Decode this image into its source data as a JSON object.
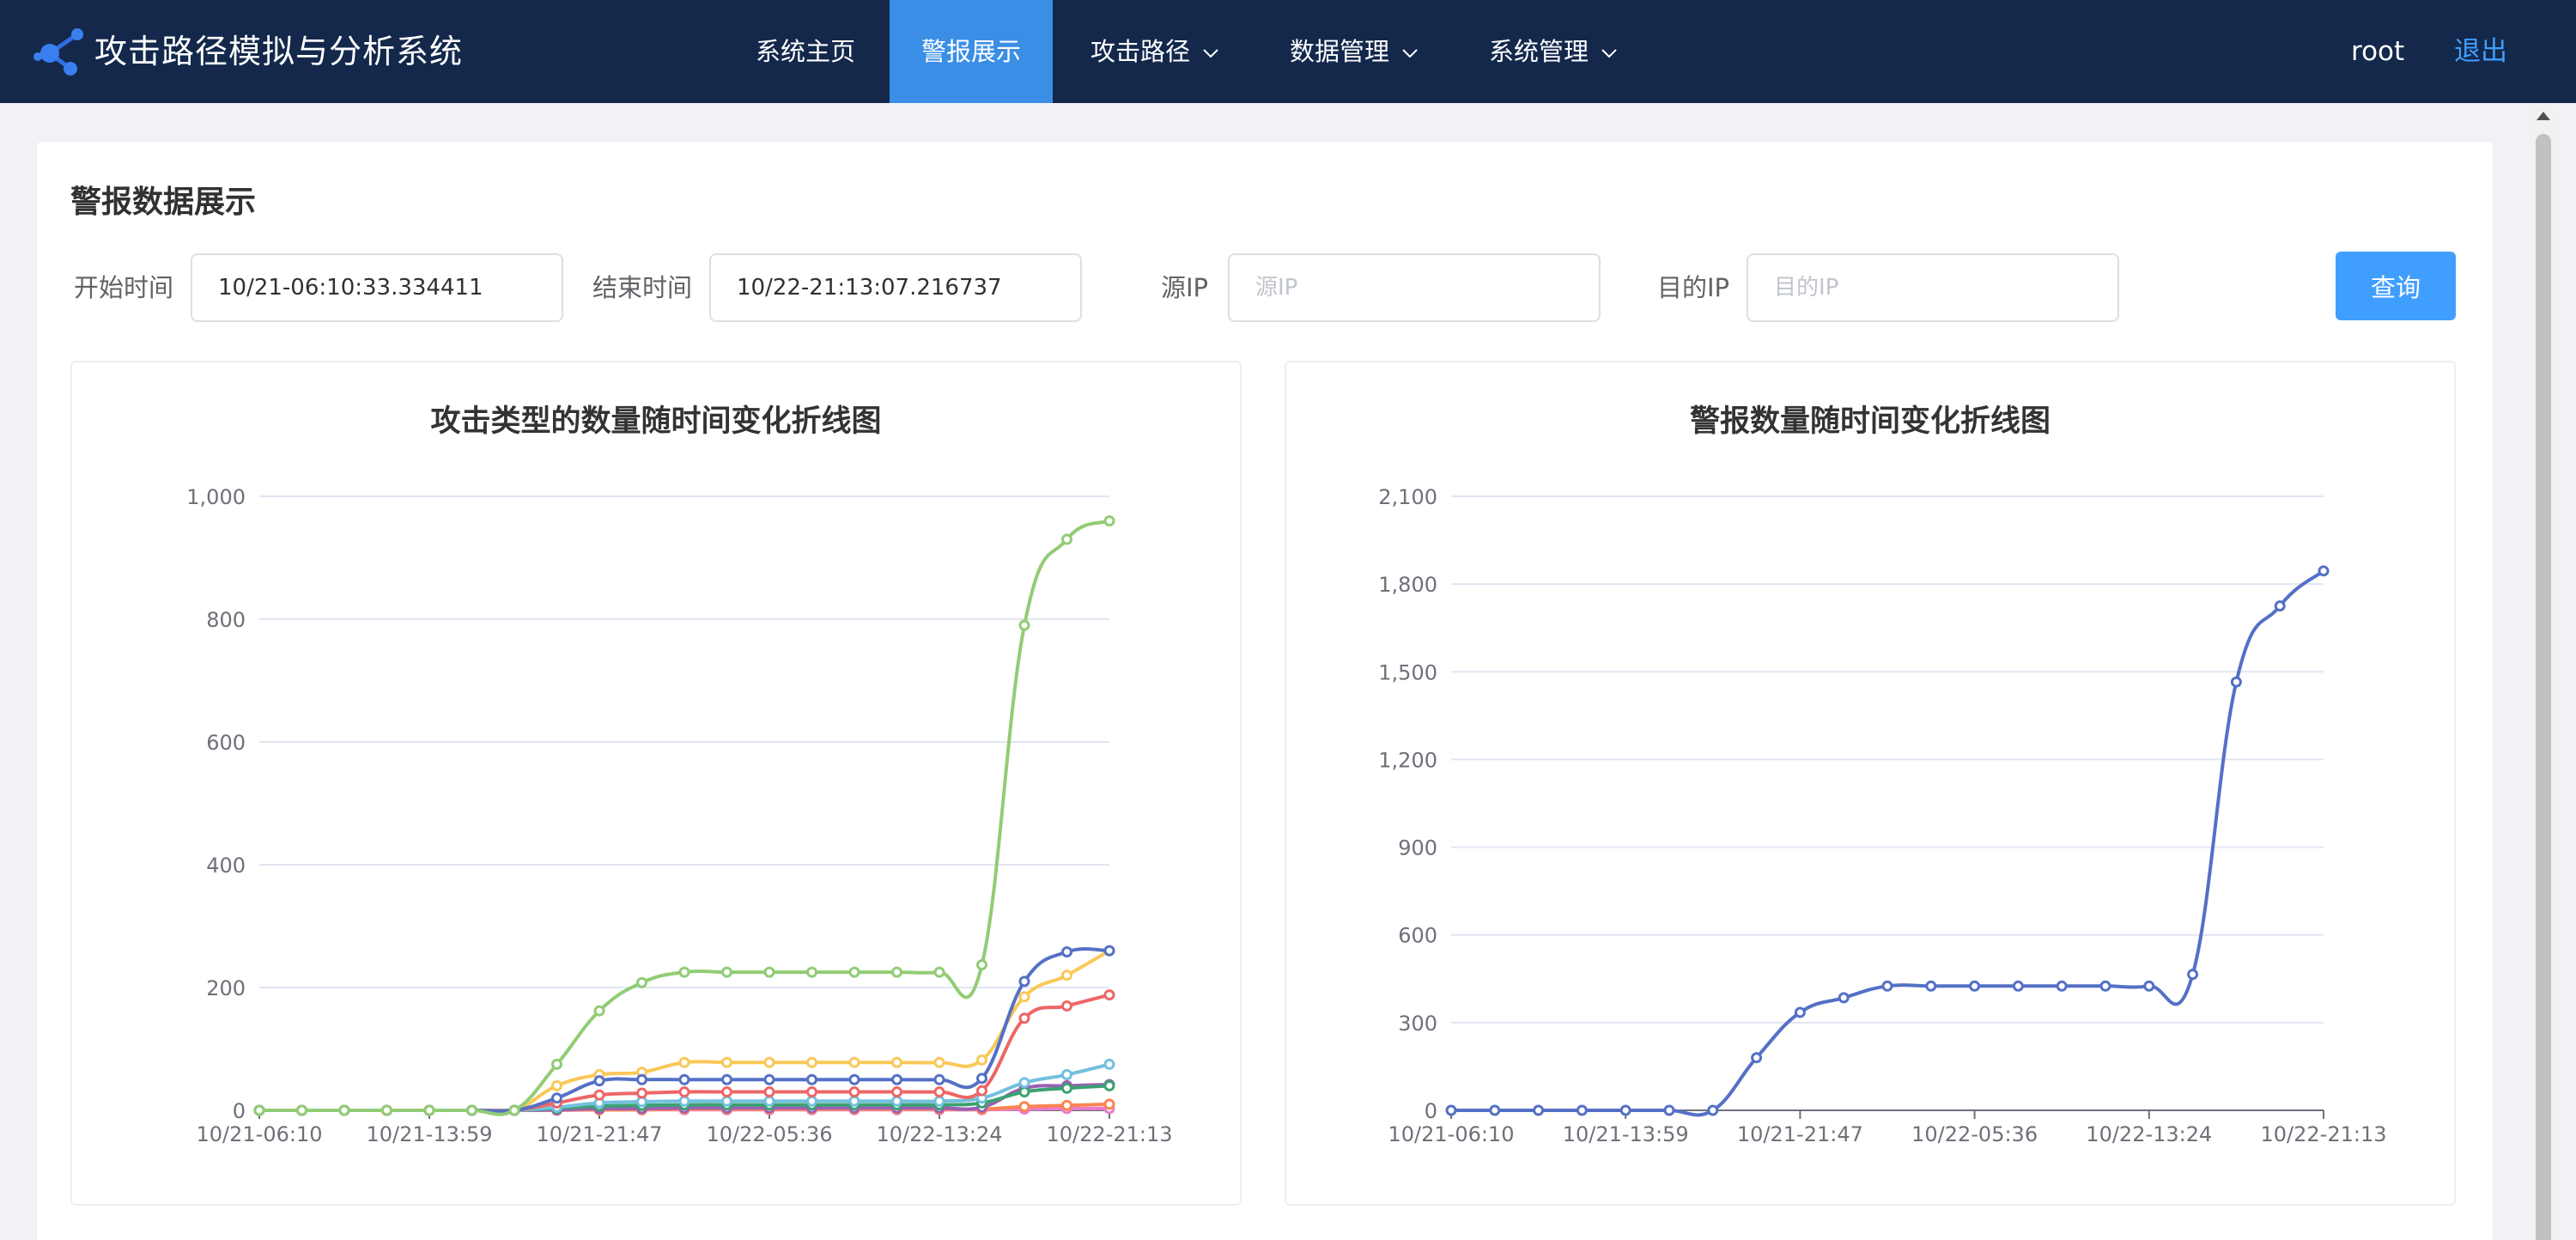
{
  "app": {
    "title": "攻击路径模拟与分析系统",
    "logo_icon": "network-nodes-icon"
  },
  "nav": {
    "items": [
      {
        "label": "系统主页",
        "active": false,
        "has_dropdown": false
      },
      {
        "label": "警报展示",
        "active": true,
        "has_dropdown": false
      },
      {
        "label": "攻击路径",
        "active": false,
        "has_dropdown": true
      },
      {
        "label": "数据管理",
        "active": false,
        "has_dropdown": true
      },
      {
        "label": "系统管理",
        "active": false,
        "has_dropdown": true
      }
    ],
    "user": "root",
    "logout": "退出"
  },
  "page": {
    "title": "警报数据展示",
    "filters": {
      "start_label": "开始时间",
      "start_value": "10/21-06:10:33.334411",
      "end_label": "结束时间",
      "end_value": "10/22-21:13:07.216737",
      "src_label": "源IP",
      "src_placeholder": "源IP",
      "dst_label": "目的IP",
      "dst_placeholder": "目的IP",
      "query_button": "查询"
    }
  },
  "colors": {
    "nav_bg": "#13284b",
    "nav_active": "#3a8ee6",
    "primary": "#409eff",
    "series": [
      "#91cc75",
      "#5470c6",
      "#fac858",
      "#ee6666",
      "#73c0de",
      "#3ba272",
      "#fc8452",
      "#9a60b4",
      "#ea7ccc"
    ]
  },
  "chart_data": [
    {
      "type": "line",
      "title": "攻击类型的数量随时间变化折线图",
      "x": [
        "10/21-06:10",
        "",
        "",
        "",
        "10/21-13:59",
        "",
        "",
        "",
        "10/21-21:47",
        "",
        "",
        "",
        "10/22-05:36",
        "",
        "",
        "",
        "10/22-13:24",
        "",
        "",
        "",
        "10/22-21:13"
      ],
      "tick_labels": [
        "10/21-06:10",
        "10/21-13:59",
        "10/21-21:47",
        "10/22-05:36",
        "10/22-13:24",
        "10/22-21:13"
      ],
      "ylim": [
        0,
        1000
      ],
      "yticks": [
        0,
        200,
        400,
        600,
        800,
        1000
      ],
      "ytick_labels": [
        "0",
        "200",
        "400",
        "600",
        "800",
        "1,000"
      ],
      "grid": true,
      "series": [
        {
          "color": "#91cc75",
          "values": [
            0,
            0,
            0,
            0,
            0,
            0,
            0,
            75,
            162,
            208,
            225,
            225,
            225,
            225,
            225,
            225,
            225,
            237,
            790,
            930,
            960
          ]
        },
        {
          "color": "#5470c6",
          "values": [
            0,
            0,
            0,
            0,
            0,
            0,
            0,
            20,
            48,
            50,
            50,
            50,
            50,
            50,
            50,
            50,
            50,
            52,
            210,
            258,
            260
          ]
        },
        {
          "color": "#fac858",
          "values": [
            0,
            0,
            0,
            0,
            0,
            0,
            0,
            40,
            58,
            62,
            78,
            78,
            78,
            78,
            78,
            78,
            78,
            82,
            185,
            220,
            260
          ]
        },
        {
          "color": "#ee6666",
          "values": [
            0,
            0,
            0,
            0,
            0,
            0,
            0,
            12,
            25,
            28,
            30,
            30,
            30,
            30,
            30,
            30,
            30,
            32,
            150,
            170,
            188
          ]
        },
        {
          "color": "#73c0de",
          "values": [
            0,
            0,
            0,
            0,
            0,
            0,
            0,
            5,
            12,
            14,
            15,
            15,
            15,
            15,
            15,
            15,
            15,
            20,
            45,
            58,
            75
          ]
        },
        {
          "color": "#3ba272",
          "values": [
            0,
            0,
            0,
            0,
            0,
            0,
            0,
            3,
            7,
            8,
            9,
            9,
            9,
            9,
            9,
            9,
            9,
            12,
            30,
            36,
            40
          ]
        },
        {
          "color": "#9a60b4",
          "values": [
            0,
            0,
            0,
            0,
            0,
            0,
            0,
            1,
            3,
            3,
            4,
            4,
            4,
            4,
            4,
            4,
            4,
            5,
            36,
            40,
            42
          ]
        },
        {
          "color": "#fc8452",
          "values": [
            0,
            0,
            0,
            0,
            0,
            0,
            0,
            1,
            1,
            1,
            2,
            2,
            2,
            2,
            2,
            2,
            2,
            2,
            6,
            8,
            10
          ]
        },
        {
          "color": "#ea7ccc",
          "values": [
            0,
            0,
            0,
            0,
            0,
            0,
            0,
            0,
            1,
            1,
            1,
            1,
            1,
            1,
            1,
            1,
            1,
            1,
            2,
            3,
            3
          ]
        }
      ]
    },
    {
      "type": "line",
      "title": "警报数量随时间变化折线图",
      "x": [
        "10/21-06:10",
        "",
        "",
        "",
        "10/21-13:59",
        "",
        "",
        "",
        "10/21-21:47",
        "",
        "",
        "",
        "10/22-05:36",
        "",
        "",
        "",
        "10/22-13:24",
        "",
        "",
        "",
        "10/22-21:13"
      ],
      "tick_labels": [
        "10/21-06:10",
        "10/21-13:59",
        "10/21-21:47",
        "10/22-05:36",
        "10/22-13:24",
        "10/22-21:13"
      ],
      "ylim": [
        0,
        2100
      ],
      "yticks": [
        0,
        300,
        600,
        900,
        1200,
        1500,
        1800,
        2100
      ],
      "ytick_labels": [
        "0",
        "300",
        "600",
        "900",
        "1,200",
        "1,500",
        "1,800",
        "2,100"
      ],
      "grid": true,
      "series": [
        {
          "color": "#5470c6",
          "values": [
            0,
            0,
            0,
            0,
            0,
            0,
            0,
            180,
            335,
            385,
            425,
            425,
            425,
            425,
            425,
            425,
            425,
            465,
            1465,
            1725,
            1845
          ]
        }
      ]
    }
  ]
}
